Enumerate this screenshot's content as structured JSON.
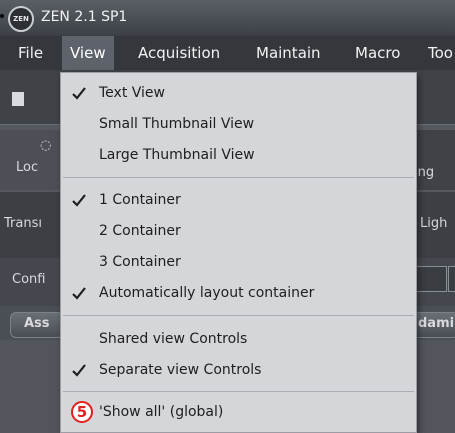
{
  "app": {
    "logo": "ZEN",
    "title": "ZEN 2.1 SP1"
  },
  "menubar": {
    "file": "File",
    "view": "View",
    "acquisition": "Acquisition",
    "maintain": "Maintain",
    "macro": "Macro",
    "tools": "Too"
  },
  "background": {
    "tab_left": "Loc",
    "tab_right": "ing",
    "row1_left": "Transı",
    "row1_right": "Ligh",
    "row2_left": "Confi",
    "btn_left": "Ass",
    "btn_right": "dami"
  },
  "view_menu": {
    "items": [
      {
        "label": "Text View",
        "checked": true
      },
      {
        "label": "Small Thumbnail View",
        "checked": false
      },
      {
        "label": "Large Thumbnail View",
        "checked": false
      },
      {
        "label": "1 Container",
        "checked": true
      },
      {
        "label": "2 Container",
        "checked": false
      },
      {
        "label": "3 Container",
        "checked": false
      },
      {
        "label": "Automatically layout container",
        "checked": true
      },
      {
        "label": "Shared view Controls",
        "checked": false
      },
      {
        "label": "Separate view Controls",
        "checked": true
      },
      {
        "label": "'Show all' (global)",
        "checked": false
      }
    ],
    "annotation_number": "5",
    "annotation_color": "#e02020"
  }
}
